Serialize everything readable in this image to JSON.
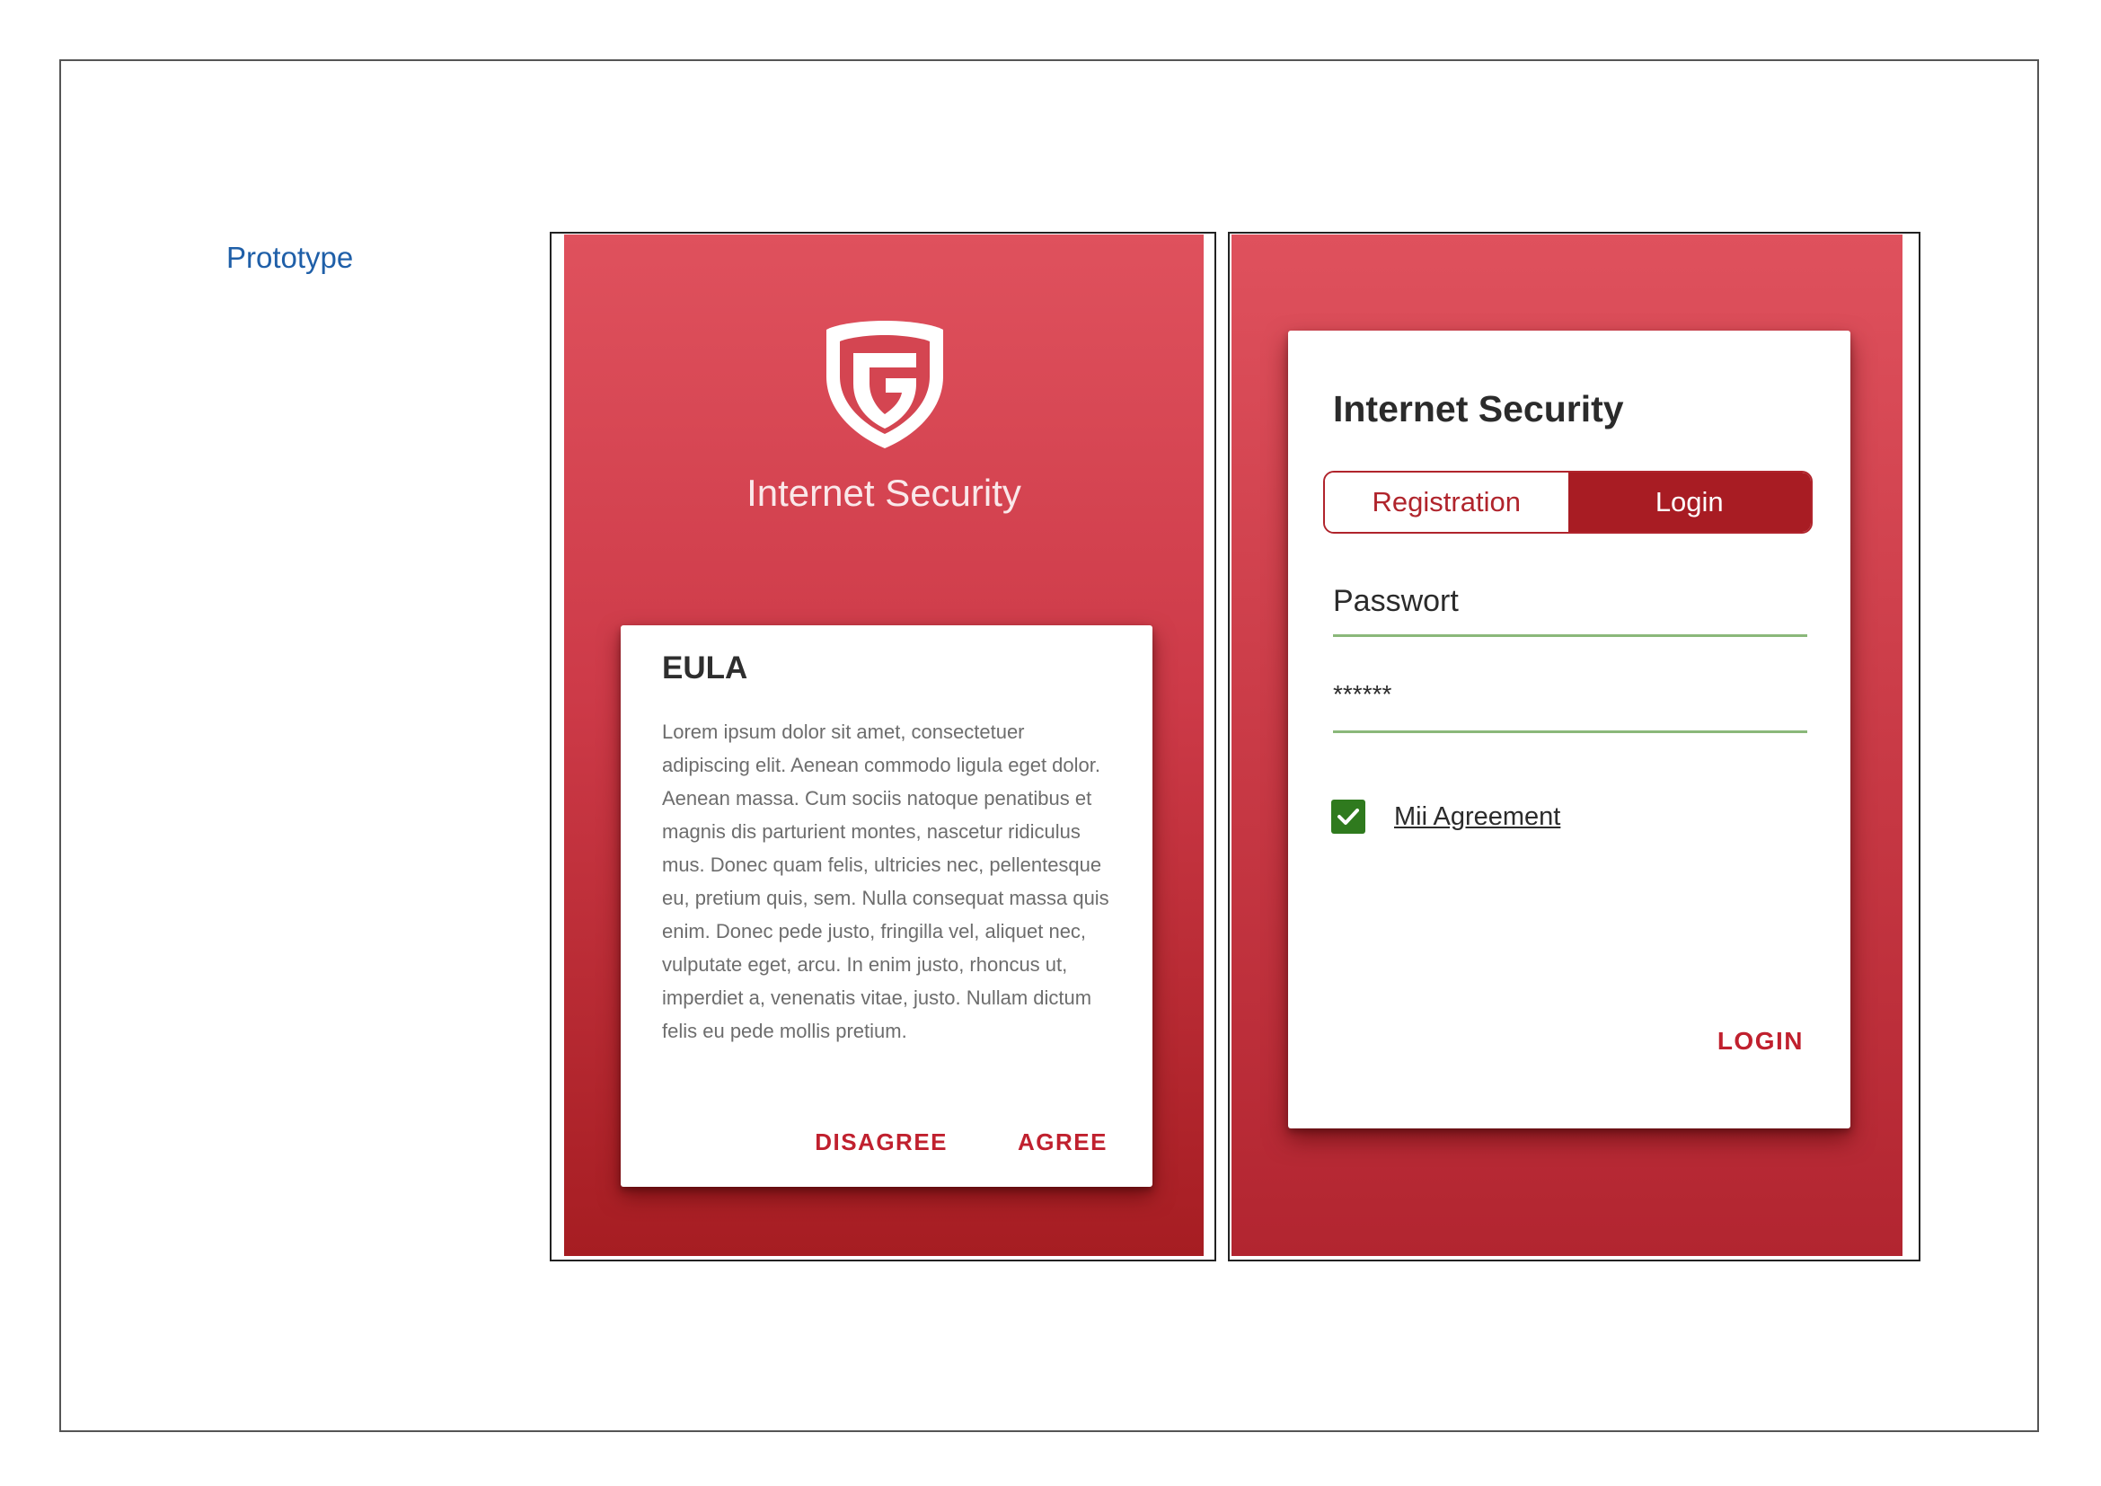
{
  "caption": "Prototype",
  "eula_screen": {
    "app_name": "Internet Security",
    "dialog": {
      "title": "EULA",
      "body": "Lorem ipsum dolor sit amet, consectetuer adipiscing elit. Aenean commodo ligula eget dolor. Aenean massa. Cum sociis natoque penatibus et magnis dis parturient montes, nascetur ridiculus mus. Donec quam felis, ultricies nec, pellentesque eu, pretium quis, sem. Nulla consequat massa quis enim. Donec pede justo, fringilla vel, aliquet nec, vulputate eget, arcu. In enim justo, rhoncus ut, imperdiet a, venenatis vitae, justo. Nullam dictum felis eu pede mollis pretium.",
      "disagree_label": "DISAGREE",
      "agree_label": "AGREE"
    }
  },
  "login_screen": {
    "title": "Internet Security",
    "tabs": [
      {
        "label": "Registration",
        "active": false
      },
      {
        "label": "Login",
        "active": true
      }
    ],
    "password_label": "Passwort",
    "password_value": "******",
    "agreement_checked": true,
    "agreement_label": "Mii Agreement",
    "login_button": "LOGIN"
  },
  "colors": {
    "primary_red": "#c0202e",
    "dark_red": "#a81c23",
    "checkbox_green": "#2f7a1e",
    "underline_green": "#8ab87a",
    "caption_blue": "#1f5fa8"
  },
  "icons": {
    "logo": "shield-g-logo-icon",
    "checkbox": "checkmark-icon"
  }
}
